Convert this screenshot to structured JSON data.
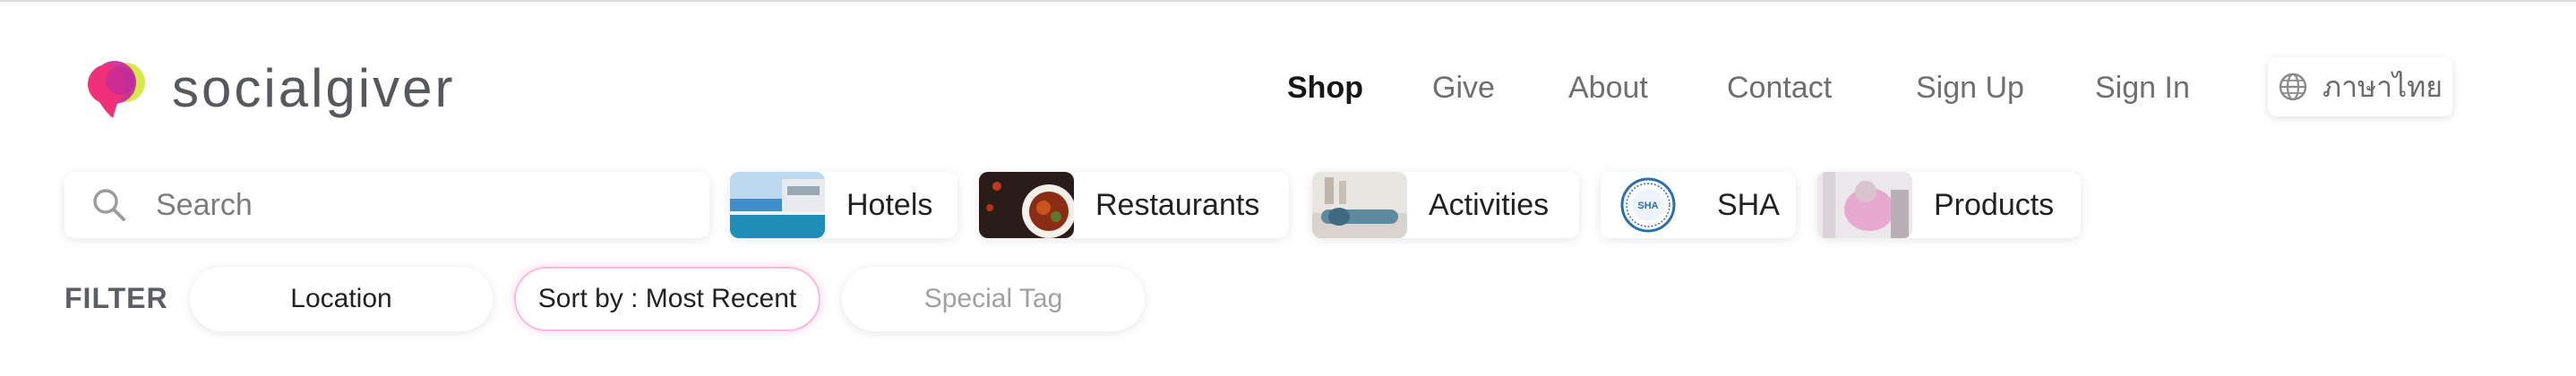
{
  "brand": {
    "name": "socialgiver"
  },
  "nav": {
    "items": [
      {
        "label": "Shop",
        "active": true
      },
      {
        "label": "Give"
      },
      {
        "label": "About"
      },
      {
        "label": "Contact"
      },
      {
        "label": "Sign Up"
      },
      {
        "label": "Sign In"
      }
    ],
    "language_label": "ภาษาไทย",
    "language_icon": "globe-icon"
  },
  "search": {
    "placeholder": "Search",
    "value": "",
    "icon": "search-icon"
  },
  "categories": [
    {
      "label": "Hotels"
    },
    {
      "label": "Restaurants"
    },
    {
      "label": "Activities"
    },
    {
      "label": "SHA"
    },
    {
      "label": "Products"
    }
  ],
  "filter": {
    "label": "FILTER",
    "location_label": "Location",
    "sort_label": "Sort by : Most Recent",
    "special_tag_label": "Special Tag"
  },
  "colors": {
    "brand_pink": "#e8347c",
    "brand_lime": "#d6e84a",
    "sort_border": "#ffb8de"
  }
}
